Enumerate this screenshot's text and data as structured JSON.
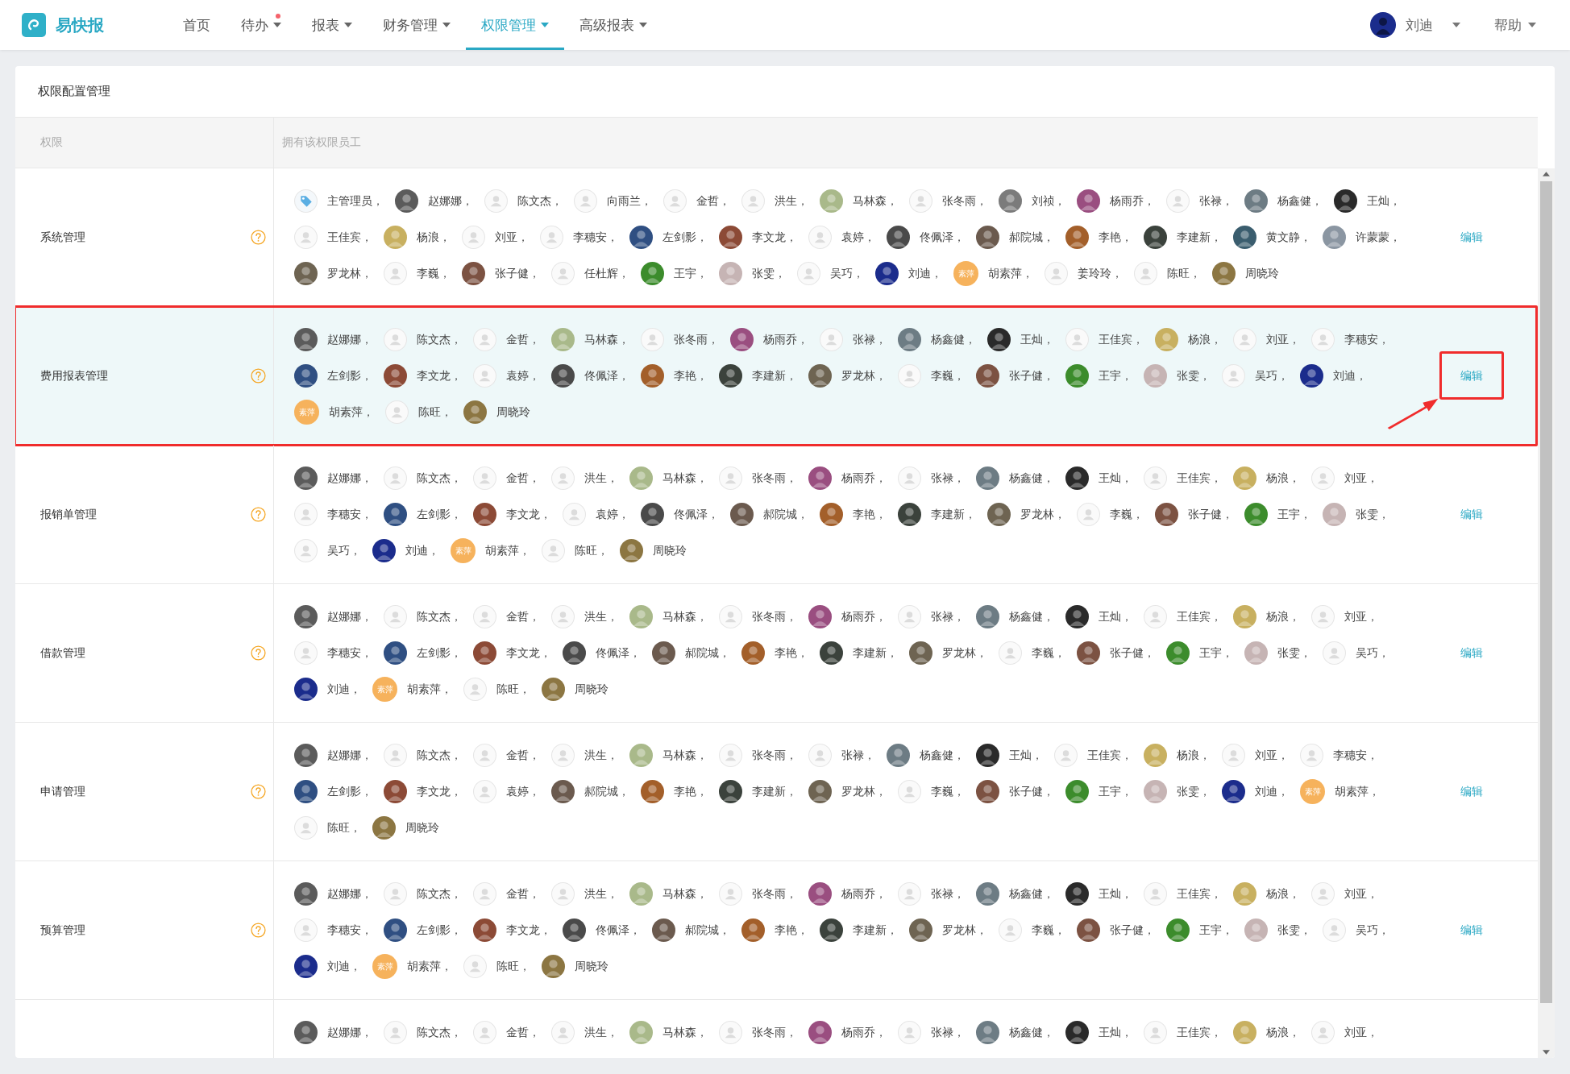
{
  "app": {
    "name": "易快报"
  },
  "nav": [
    {
      "label": "首页",
      "selected": false,
      "dropdown": false,
      "dot": false
    },
    {
      "label": "待办",
      "selected": false,
      "dropdown": true,
      "dot": true
    },
    {
      "label": "报表",
      "selected": false,
      "dropdown": true,
      "dot": false
    },
    {
      "label": "财务管理",
      "selected": false,
      "dropdown": true,
      "dot": false
    },
    {
      "label": "权限管理",
      "selected": true,
      "dropdown": true,
      "dot": false
    },
    {
      "label": "高级报表",
      "selected": false,
      "dropdown": true,
      "dot": false
    }
  ],
  "user": {
    "name": "刘迪",
    "color": "#1b2c8c"
  },
  "help": "帮助",
  "card": {
    "title": "权限配置管理"
  },
  "columns": [
    "权限",
    "拥有该权限员工"
  ],
  "rows": [
    {
      "label": "系统管理",
      "edit": "编辑",
      "highlighted": false,
      "edit_annotated": false,
      "lines": [
        [
          {
            "name": "主管理员，",
            "kind": "tag"
          },
          {
            "name": "赵娜娜，",
            "kind": "photo",
            "color": "#5b5b5b"
          },
          {
            "name": "陈文杰，",
            "kind": "blank"
          },
          {
            "name": "向雨兰，",
            "kind": "blank"
          },
          {
            "name": "金哲，",
            "kind": "blank"
          },
          {
            "name": "洪生，",
            "kind": "blank"
          },
          {
            "name": "马林森，",
            "kind": "photo",
            "color": "#a9b98a"
          },
          {
            "name": "张冬雨，",
            "kind": "blank"
          },
          {
            "name": "刘祯，",
            "kind": "photo",
            "color": "#7b7b7b"
          },
          {
            "name": "杨雨乔，",
            "kind": "photo",
            "color": "#9a4e80"
          },
          {
            "name": "张禄，",
            "kind": "blank"
          },
          {
            "name": "杨鑫健，",
            "kind": "photo",
            "color": "#6d7c84"
          },
          {
            "name": "王灿，",
            "kind": "photo",
            "color": "#2a2a2a"
          }
        ],
        [
          {
            "name": "王佳宾，",
            "kind": "blank"
          },
          {
            "name": "杨浪，",
            "kind": "photo",
            "color": "#c8b060"
          },
          {
            "name": "刘亚，",
            "kind": "blank"
          },
          {
            "name": "李穗安，",
            "kind": "blank"
          },
          {
            "name": "左剑影，",
            "kind": "photo",
            "color": "#2f4f82"
          },
          {
            "name": "李文龙，",
            "kind": "photo",
            "color": "#8c4a36"
          },
          {
            "name": "袁婷，",
            "kind": "blank"
          },
          {
            "name": "佟佩泽，",
            "kind": "photo",
            "color": "#4a4a4a"
          },
          {
            "name": "郝院城，",
            "kind": "photo",
            "color": "#6b5a4e"
          },
          {
            "name": "李艳，",
            "kind": "photo",
            "color": "#a35f2a"
          },
          {
            "name": "李建新，",
            "kind": "photo",
            "color": "#3b423c"
          },
          {
            "name": "黄文静，",
            "kind": "photo",
            "color": "#3a5d6e"
          },
          {
            "name": "许蒙蒙，",
            "kind": "photo",
            "color": "#8b96a2"
          }
        ],
        [
          {
            "name": "罗龙林，",
            "kind": "photo",
            "color": "#6e6452"
          },
          {
            "name": "李巍，",
            "kind": "blank"
          },
          {
            "name": "张子健，",
            "kind": "photo",
            "color": "#7c5242"
          },
          {
            "name": "任杜辉，",
            "kind": "blank"
          },
          {
            "name": "王宇，",
            "kind": "photo",
            "color": "#3c8c2c"
          },
          {
            "name": "张雯，",
            "kind": "photo",
            "color": "#c6b4b4"
          },
          {
            "name": "吴巧，",
            "kind": "blank"
          },
          {
            "name": "刘迪，",
            "kind": "photo",
            "color": "#1b2c8c"
          },
          {
            "name": "胡素萍，",
            "kind": "badge",
            "badge": "素萍"
          },
          {
            "name": "姜玲玲，",
            "kind": "blank"
          },
          {
            "name": "陈旺，",
            "kind": "blank"
          },
          {
            "name": "周晓玲",
            "kind": "photo",
            "color": "#8c7642"
          }
        ]
      ]
    },
    {
      "label": "费用报表管理",
      "edit": "编辑",
      "highlighted": true,
      "edit_annotated": true,
      "lines": [
        [
          {
            "name": "赵娜娜，",
            "kind": "photo",
            "color": "#5b5b5b"
          },
          {
            "name": "陈文杰，",
            "kind": "blank"
          },
          {
            "name": "金哲，",
            "kind": "blank"
          },
          {
            "name": "马林森，",
            "kind": "photo",
            "color": "#a9b98a"
          },
          {
            "name": "张冬雨，",
            "kind": "blank"
          },
          {
            "name": "杨雨乔，",
            "kind": "photo",
            "color": "#9a4e80"
          },
          {
            "name": "张禄，",
            "kind": "blank"
          },
          {
            "name": "杨鑫健，",
            "kind": "photo",
            "color": "#6d7c84"
          },
          {
            "name": "王灿，",
            "kind": "photo",
            "color": "#2a2a2a"
          },
          {
            "name": "王佳宾，",
            "kind": "blank"
          },
          {
            "name": "杨浪，",
            "kind": "photo",
            "color": "#c8b060"
          },
          {
            "name": "刘亚，",
            "kind": "blank"
          },
          {
            "name": "李穗安，",
            "kind": "blank"
          }
        ],
        [
          {
            "name": "左剑影，",
            "kind": "photo",
            "color": "#2f4f82"
          },
          {
            "name": "李文龙，",
            "kind": "photo",
            "color": "#8c4a36"
          },
          {
            "name": "袁婷，",
            "kind": "blank"
          },
          {
            "name": "佟佩泽，",
            "kind": "photo",
            "color": "#4a4a4a"
          },
          {
            "name": "李艳，",
            "kind": "photo",
            "color": "#a35f2a"
          },
          {
            "name": "李建新，",
            "kind": "photo",
            "color": "#3b423c"
          },
          {
            "name": "罗龙林，",
            "kind": "photo",
            "color": "#6e6452"
          },
          {
            "name": "李巍，",
            "kind": "blank"
          },
          {
            "name": "张子健，",
            "kind": "photo",
            "color": "#7c5242"
          },
          {
            "name": "王宇，",
            "kind": "photo",
            "color": "#3c8c2c"
          },
          {
            "name": "张雯，",
            "kind": "photo",
            "color": "#c6b4b4"
          },
          {
            "name": "吴巧，",
            "kind": "blank"
          },
          {
            "name": "刘迪，",
            "kind": "photo",
            "color": "#1b2c8c"
          }
        ],
        [
          {
            "name": "胡素萍，",
            "kind": "badge",
            "badge": "素萍"
          },
          {
            "name": "陈旺，",
            "kind": "blank"
          },
          {
            "name": "周晓玲",
            "kind": "photo",
            "color": "#8c7642"
          }
        ]
      ]
    },
    {
      "label": "报销单管理",
      "edit": "编辑",
      "highlighted": false,
      "edit_annotated": false,
      "lines": [
        [
          {
            "name": "赵娜娜，",
            "kind": "photo",
            "color": "#5b5b5b"
          },
          {
            "name": "陈文杰，",
            "kind": "blank"
          },
          {
            "name": "金哲，",
            "kind": "blank"
          },
          {
            "name": "洪生，",
            "kind": "blank"
          },
          {
            "name": "马林森，",
            "kind": "photo",
            "color": "#a9b98a"
          },
          {
            "name": "张冬雨，",
            "kind": "blank"
          },
          {
            "name": "杨雨乔，",
            "kind": "photo",
            "color": "#9a4e80"
          },
          {
            "name": "张禄，",
            "kind": "blank"
          },
          {
            "name": "杨鑫健，",
            "kind": "photo",
            "color": "#6d7c84"
          },
          {
            "name": "王灿，",
            "kind": "photo",
            "color": "#2a2a2a"
          },
          {
            "name": "王佳宾，",
            "kind": "blank"
          },
          {
            "name": "杨浪，",
            "kind": "photo",
            "color": "#c8b060"
          },
          {
            "name": "刘亚，",
            "kind": "blank"
          }
        ],
        [
          {
            "name": "李穗安，",
            "kind": "blank"
          },
          {
            "name": "左剑影，",
            "kind": "photo",
            "color": "#2f4f82"
          },
          {
            "name": "李文龙，",
            "kind": "photo",
            "color": "#8c4a36"
          },
          {
            "name": "袁婷，",
            "kind": "blank"
          },
          {
            "name": "佟佩泽，",
            "kind": "photo",
            "color": "#4a4a4a"
          },
          {
            "name": "郝院城，",
            "kind": "photo",
            "color": "#6b5a4e"
          },
          {
            "name": "李艳，",
            "kind": "photo",
            "color": "#a35f2a"
          },
          {
            "name": "李建新，",
            "kind": "photo",
            "color": "#3b423c"
          },
          {
            "name": "罗龙林，",
            "kind": "photo",
            "color": "#6e6452"
          },
          {
            "name": "李巍，",
            "kind": "blank"
          },
          {
            "name": "张子健，",
            "kind": "photo",
            "color": "#7c5242"
          },
          {
            "name": "王宇，",
            "kind": "photo",
            "color": "#3c8c2c"
          },
          {
            "name": "张雯，",
            "kind": "photo",
            "color": "#c6b4b4"
          }
        ],
        [
          {
            "name": "吴巧，",
            "kind": "blank"
          },
          {
            "name": "刘迪，",
            "kind": "photo",
            "color": "#1b2c8c"
          },
          {
            "name": "胡素萍，",
            "kind": "badge",
            "badge": "素萍"
          },
          {
            "name": "陈旺，",
            "kind": "blank"
          },
          {
            "name": "周晓玲",
            "kind": "photo",
            "color": "#8c7642"
          }
        ]
      ]
    },
    {
      "label": "借款管理",
      "edit": "编辑",
      "highlighted": false,
      "edit_annotated": false,
      "lines": [
        [
          {
            "name": "赵娜娜，",
            "kind": "photo",
            "color": "#5b5b5b"
          },
          {
            "name": "陈文杰，",
            "kind": "blank"
          },
          {
            "name": "金哲，",
            "kind": "blank"
          },
          {
            "name": "洪生，",
            "kind": "blank"
          },
          {
            "name": "马林森，",
            "kind": "photo",
            "color": "#a9b98a"
          },
          {
            "name": "张冬雨，",
            "kind": "blank"
          },
          {
            "name": "杨雨乔，",
            "kind": "photo",
            "color": "#9a4e80"
          },
          {
            "name": "张禄，",
            "kind": "blank"
          },
          {
            "name": "杨鑫健，",
            "kind": "photo",
            "color": "#6d7c84"
          },
          {
            "name": "王灿，",
            "kind": "photo",
            "color": "#2a2a2a"
          },
          {
            "name": "王佳宾，",
            "kind": "blank"
          },
          {
            "name": "杨浪，",
            "kind": "photo",
            "color": "#c8b060"
          },
          {
            "name": "刘亚，",
            "kind": "blank"
          }
        ],
        [
          {
            "name": "李穗安，",
            "kind": "blank"
          },
          {
            "name": "左剑影，",
            "kind": "photo",
            "color": "#2f4f82"
          },
          {
            "name": "李文龙，",
            "kind": "photo",
            "color": "#8c4a36"
          },
          {
            "name": "佟佩泽，",
            "kind": "photo",
            "color": "#4a4a4a"
          },
          {
            "name": "郝院城，",
            "kind": "photo",
            "color": "#6b5a4e"
          },
          {
            "name": "李艳，",
            "kind": "photo",
            "color": "#a35f2a"
          },
          {
            "name": "李建新，",
            "kind": "photo",
            "color": "#3b423c"
          },
          {
            "name": "罗龙林，",
            "kind": "photo",
            "color": "#6e6452"
          },
          {
            "name": "李巍，",
            "kind": "blank"
          },
          {
            "name": "张子健，",
            "kind": "photo",
            "color": "#7c5242"
          },
          {
            "name": "王宇，",
            "kind": "photo",
            "color": "#3c8c2c"
          },
          {
            "name": "张雯，",
            "kind": "photo",
            "color": "#c6b4b4"
          },
          {
            "name": "吴巧，",
            "kind": "blank"
          }
        ],
        [
          {
            "name": "刘迪，",
            "kind": "photo",
            "color": "#1b2c8c"
          },
          {
            "name": "胡素萍，",
            "kind": "badge",
            "badge": "素萍"
          },
          {
            "name": "陈旺，",
            "kind": "blank"
          },
          {
            "name": "周晓玲",
            "kind": "photo",
            "color": "#8c7642"
          }
        ]
      ]
    },
    {
      "label": "申请管理",
      "edit": "编辑",
      "highlighted": false,
      "edit_annotated": false,
      "lines": [
        [
          {
            "name": "赵娜娜，",
            "kind": "photo",
            "color": "#5b5b5b"
          },
          {
            "name": "陈文杰，",
            "kind": "blank"
          },
          {
            "name": "金哲，",
            "kind": "blank"
          },
          {
            "name": "洪生，",
            "kind": "blank"
          },
          {
            "name": "马林森，",
            "kind": "photo",
            "color": "#a9b98a"
          },
          {
            "name": "张冬雨，",
            "kind": "blank"
          },
          {
            "name": "张禄，",
            "kind": "blank"
          },
          {
            "name": "杨鑫健，",
            "kind": "photo",
            "color": "#6d7c84"
          },
          {
            "name": "王灿，",
            "kind": "photo",
            "color": "#2a2a2a"
          },
          {
            "name": "王佳宾，",
            "kind": "blank"
          },
          {
            "name": "杨浪，",
            "kind": "photo",
            "color": "#c8b060"
          },
          {
            "name": "刘亚，",
            "kind": "blank"
          },
          {
            "name": "李穗安，",
            "kind": "blank"
          }
        ],
        [
          {
            "name": "左剑影，",
            "kind": "photo",
            "color": "#2f4f82"
          },
          {
            "name": "李文龙，",
            "kind": "photo",
            "color": "#8c4a36"
          },
          {
            "name": "袁婷，",
            "kind": "blank"
          },
          {
            "name": "郝院城，",
            "kind": "photo",
            "color": "#6b5a4e"
          },
          {
            "name": "李艳，",
            "kind": "photo",
            "color": "#a35f2a"
          },
          {
            "name": "李建新，",
            "kind": "photo",
            "color": "#3b423c"
          },
          {
            "name": "罗龙林，",
            "kind": "photo",
            "color": "#6e6452"
          },
          {
            "name": "李巍，",
            "kind": "blank"
          },
          {
            "name": "张子健，",
            "kind": "photo",
            "color": "#7c5242"
          },
          {
            "name": "王宇，",
            "kind": "photo",
            "color": "#3c8c2c"
          },
          {
            "name": "张雯，",
            "kind": "photo",
            "color": "#c6b4b4"
          },
          {
            "name": "刘迪，",
            "kind": "photo",
            "color": "#1b2c8c"
          },
          {
            "name": "胡素萍，",
            "kind": "badge",
            "badge": "素萍"
          }
        ],
        [
          {
            "name": "陈旺，",
            "kind": "blank"
          },
          {
            "name": "周晓玲",
            "kind": "photo",
            "color": "#8c7642"
          }
        ]
      ]
    },
    {
      "label": "预算管理",
      "edit": "编辑",
      "highlighted": false,
      "edit_annotated": false,
      "lines": [
        [
          {
            "name": "赵娜娜，",
            "kind": "photo",
            "color": "#5b5b5b"
          },
          {
            "name": "陈文杰，",
            "kind": "blank"
          },
          {
            "name": "金哲，",
            "kind": "blank"
          },
          {
            "name": "洪生，",
            "kind": "blank"
          },
          {
            "name": "马林森，",
            "kind": "photo",
            "color": "#a9b98a"
          },
          {
            "name": "张冬雨，",
            "kind": "blank"
          },
          {
            "name": "杨雨乔，",
            "kind": "photo",
            "color": "#9a4e80"
          },
          {
            "name": "张禄，",
            "kind": "blank"
          },
          {
            "name": "杨鑫健，",
            "kind": "photo",
            "color": "#6d7c84"
          },
          {
            "name": "王灿，",
            "kind": "photo",
            "color": "#2a2a2a"
          },
          {
            "name": "王佳宾，",
            "kind": "blank"
          },
          {
            "name": "杨浪，",
            "kind": "photo",
            "color": "#c8b060"
          },
          {
            "name": "刘亚，",
            "kind": "blank"
          }
        ],
        [
          {
            "name": "李穗安，",
            "kind": "blank"
          },
          {
            "name": "左剑影，",
            "kind": "photo",
            "color": "#2f4f82"
          },
          {
            "name": "李文龙，",
            "kind": "photo",
            "color": "#8c4a36"
          },
          {
            "name": "佟佩泽，",
            "kind": "photo",
            "color": "#4a4a4a"
          },
          {
            "name": "郝院城，",
            "kind": "photo",
            "color": "#6b5a4e"
          },
          {
            "name": "李艳，",
            "kind": "photo",
            "color": "#a35f2a"
          },
          {
            "name": "李建新，",
            "kind": "photo",
            "color": "#3b423c"
          },
          {
            "name": "罗龙林，",
            "kind": "photo",
            "color": "#6e6452"
          },
          {
            "name": "李巍，",
            "kind": "blank"
          },
          {
            "name": "张子健，",
            "kind": "photo",
            "color": "#7c5242"
          },
          {
            "name": "王宇，",
            "kind": "photo",
            "color": "#3c8c2c"
          },
          {
            "name": "张雯，",
            "kind": "photo",
            "color": "#c6b4b4"
          },
          {
            "name": "吴巧，",
            "kind": "blank"
          }
        ],
        [
          {
            "name": "刘迪，",
            "kind": "photo",
            "color": "#1b2c8c"
          },
          {
            "name": "胡素萍，",
            "kind": "badge",
            "badge": "素萍"
          },
          {
            "name": "陈旺，",
            "kind": "blank"
          },
          {
            "name": "周晓玲",
            "kind": "photo",
            "color": "#8c7642"
          }
        ]
      ]
    },
    {
      "highlighted": false,
      "edit_annotated": false,
      "lines": [
        [
          {
            "name": "赵娜娜，",
            "kind": "photo",
            "color": "#5b5b5b"
          },
          {
            "name": "陈文杰，",
            "kind": "blank"
          },
          {
            "name": "金哲，",
            "kind": "blank"
          },
          {
            "name": "洪生，",
            "kind": "blank"
          },
          {
            "name": "马林森，",
            "kind": "photo",
            "color": "#a9b98a"
          },
          {
            "name": "张冬雨，",
            "kind": "blank"
          },
          {
            "name": "杨雨乔，",
            "kind": "photo",
            "color": "#9a4e80"
          },
          {
            "name": "张禄，",
            "kind": "blank"
          },
          {
            "name": "杨鑫健，",
            "kind": "photo",
            "color": "#6d7c84"
          },
          {
            "name": "王灿，",
            "kind": "photo",
            "color": "#2a2a2a"
          },
          {
            "name": "王佳宾，",
            "kind": "blank"
          },
          {
            "name": "杨浪，",
            "kind": "photo",
            "color": "#c8b060"
          },
          {
            "name": "刘亚，",
            "kind": "blank"
          }
        ]
      ]
    }
  ]
}
